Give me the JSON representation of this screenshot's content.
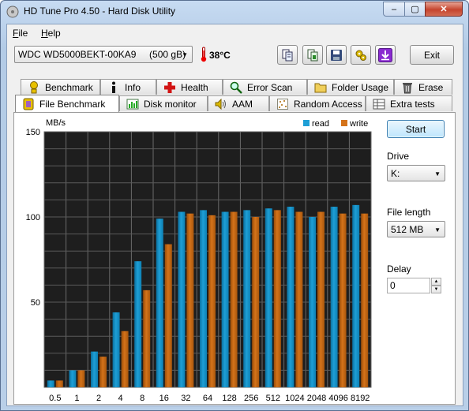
{
  "window": {
    "title": "HD Tune Pro 4.50 - Hard Disk Utility",
    "min_glyph": "‒",
    "max_glyph": "▢",
    "close_glyph": "✕"
  },
  "menu": {
    "file": "ile",
    "file_accel": "F",
    "help": "elp",
    "help_accel": "H"
  },
  "toolbar": {
    "drive": "WDC WD5000BEKT-00KA9     (500 gB)",
    "temperature": "38°C",
    "exit_label": "Exit",
    "icons": [
      "copy-text-icon",
      "copy-screen-icon",
      "save-icon",
      "options-icon",
      "download-icon"
    ]
  },
  "tabs_top": [
    {
      "label": "Benchmark",
      "icon": "benchmark-icon"
    },
    {
      "label": "Info",
      "icon": "info-icon"
    },
    {
      "label": "Health",
      "icon": "health-icon"
    },
    {
      "label": "Error Scan",
      "icon": "error-scan-icon"
    },
    {
      "label": "Folder Usage",
      "icon": "folder-icon"
    },
    {
      "label": "Erase",
      "icon": "erase-icon"
    }
  ],
  "tabs_bottom": [
    {
      "label": "File Benchmark",
      "icon": "file-benchmark-icon",
      "active": true
    },
    {
      "label": "Disk monitor",
      "icon": "disk-monitor-icon"
    },
    {
      "label": "AAM",
      "icon": "speaker-icon"
    },
    {
      "label": "Random Access",
      "icon": "random-access-icon"
    },
    {
      "label": "Extra tests",
      "icon": "extra-tests-icon"
    }
  ],
  "controls": {
    "start_label": "Start",
    "drive_label": "Drive",
    "drive_value": "K:",
    "file_length_label": "File length",
    "file_length_value": "512 MB",
    "delay_label": "Delay",
    "delay_value": "0"
  },
  "colors": {
    "read": "#1e9fd6",
    "write": "#d4731a",
    "plot_bg": "#1e1e1e",
    "accent": "#3c7fb1"
  },
  "chart_data": {
    "type": "bar",
    "ylabel": "MB/s",
    "ylim": [
      0,
      150
    ],
    "yticks": [
      "150",
      "100",
      "50"
    ],
    "grid": true,
    "legend": "top-right",
    "categories": [
      "0.5",
      "1",
      "2",
      "4",
      "8",
      "16",
      "32",
      "64",
      "128",
      "256",
      "512",
      "1024",
      "2048",
      "4096",
      "8192"
    ],
    "series": [
      {
        "name": "read",
        "values": [
          4,
          10,
          21,
          44,
          74,
          99,
          103,
          104,
          103,
          104,
          105,
          106,
          100,
          106,
          107
        ]
      },
      {
        "name": "write",
        "values": [
          4,
          10,
          18,
          33,
          57,
          84,
          102,
          101,
          103,
          100,
          104,
          103,
          103,
          102,
          102
        ]
      }
    ]
  }
}
